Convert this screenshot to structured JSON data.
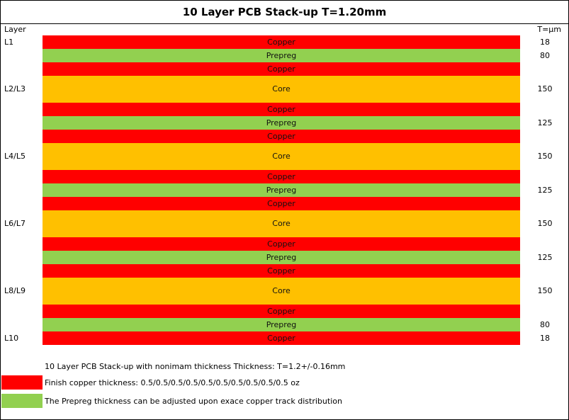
{
  "title": "10 Layer PCB Stack-up T=1.20mm",
  "header": {
    "layer": "Layer",
    "thickness": "T=µm"
  },
  "colors": {
    "copper": "#ff0000",
    "prepreg": "#92d050",
    "core": "#ffc000"
  },
  "stack": [
    {
      "material": "Copper",
      "type": "copper",
      "layer": "L1",
      "thickness": "18"
    },
    {
      "material": "Prepreg",
      "type": "prepreg",
      "layer": "",
      "thickness": "80"
    },
    {
      "material": "Copper",
      "type": "copper",
      "layer": "",
      "thickness": ""
    },
    {
      "material": "Core",
      "type": "core",
      "layer": "L2/L3",
      "thickness": "150"
    },
    {
      "material": "Copper",
      "type": "copper",
      "layer": "",
      "thickness": ""
    },
    {
      "material": "Prepreg",
      "type": "prepreg",
      "layer": "",
      "thickness": "125"
    },
    {
      "material": "Copper",
      "type": "copper",
      "layer": "",
      "thickness": ""
    },
    {
      "material": "Core",
      "type": "core",
      "layer": "L4/L5",
      "thickness": "150"
    },
    {
      "material": "Copper",
      "type": "copper",
      "layer": "",
      "thickness": ""
    },
    {
      "material": "Prepreg",
      "type": "prepreg",
      "layer": "",
      "thickness": "125"
    },
    {
      "material": "Copper",
      "type": "copper",
      "layer": "",
      "thickness": ""
    },
    {
      "material": "Core",
      "type": "core",
      "layer": "L6/L7",
      "thickness": "150"
    },
    {
      "material": "Copper",
      "type": "copper",
      "layer": "",
      "thickness": ""
    },
    {
      "material": "Prepreg",
      "type": "prepreg",
      "layer": "",
      "thickness": "125"
    },
    {
      "material": "Copper",
      "type": "copper",
      "layer": "",
      "thickness": ""
    },
    {
      "material": "Core",
      "type": "core",
      "layer": "L8/L9",
      "thickness": "150"
    },
    {
      "material": "Copper",
      "type": "copper",
      "layer": "",
      "thickness": ""
    },
    {
      "material": "Prepreg",
      "type": "prepreg",
      "layer": "",
      "thickness": "80"
    },
    {
      "material": "Copper",
      "type": "copper",
      "layer": "L10",
      "thickness": "18"
    }
  ],
  "notes": {
    "summary": "10 Layer PCB Stack-up with nonimam thickness Thickness: T=1.2+/-0.16mm",
    "copper": "Finish copper thickness: 0.5/0.5/0.5/0.5/0.5/0.5/0.5/0.5/0.5/0.5 oz",
    "prepreg": "The Prepreg thickness can be adjusted upon exace copper track distribution"
  }
}
